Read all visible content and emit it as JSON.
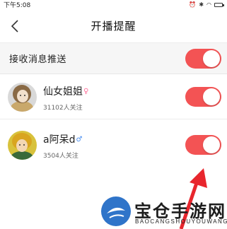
{
  "status_bar": {
    "time": "下午5:08",
    "icons": [
      "alarm-icon",
      "bluetooth-icon",
      "wifi-icon",
      "battery-icon"
    ]
  },
  "header": {
    "title": "开播提醒",
    "back_icon": "chevron-left-icon"
  },
  "push_setting": {
    "label": "接收消息推送",
    "enabled": true
  },
  "streamers": [
    {
      "name": "仙女姐姐",
      "gender": "female",
      "gender_symbol": "♀",
      "followers": "31102人关注",
      "reminder_enabled": true
    },
    {
      "name": "a阿呆d",
      "gender": "male",
      "gender_symbol": "♂",
      "followers": "3504人关注",
      "reminder_enabled": true
    }
  ],
  "colors": {
    "accent": "#f35354",
    "arrow": "#e8262d",
    "female": "#ff6f9a",
    "male": "#4b8ff0"
  },
  "watermark": {
    "title": "宝仓手游网",
    "subtitle": "BAOCANGSHOUYOUWANG"
  }
}
